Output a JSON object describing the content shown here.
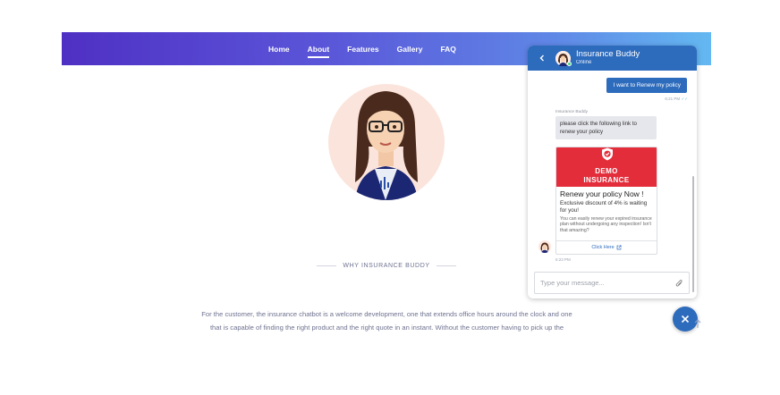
{
  "nav": {
    "items": [
      {
        "label": "Home"
      },
      {
        "label": "About"
      },
      {
        "label": "Features"
      },
      {
        "label": "Gallery"
      },
      {
        "label": "FAQ"
      }
    ],
    "active": "About"
  },
  "section": {
    "heading": "WHY INSURANCE BUDDY",
    "body_line1": "For the customer, the insurance chatbot is a welcome development, one that extends office hours around the clock and one",
    "body_line2": "that is capable of finding the right product and the right quote in an instant. Without the customer having to pick up the"
  },
  "chat": {
    "title": "Insurance Buddy",
    "status": "Online",
    "user_message": "I want to Renew my policy",
    "user_time": "6:21 PM",
    "bot_label": "Insurance Buddy",
    "bot_message": "please click the following link to renew your policy",
    "card": {
      "brand_line1": "DEMO",
      "brand_line2": "INSURANCE",
      "title": "Renew your policy Now !",
      "subtitle": "Exclusive discount of 4% is waiting for you!",
      "description": "You can easily renew your expired insurance plan without undergoing any inspection! Isn't that amazing?",
      "link_label": "Click Here"
    },
    "bot_time": "6:23 PM",
    "input_placeholder": "Type your message..."
  },
  "colors": {
    "header_gradient_start": "#4f30c4",
    "header_gradient_end": "#63b8f1",
    "chat_primary": "#2d6bbd",
    "card_banner": "#e32d3b",
    "online": "#3fd37a"
  }
}
